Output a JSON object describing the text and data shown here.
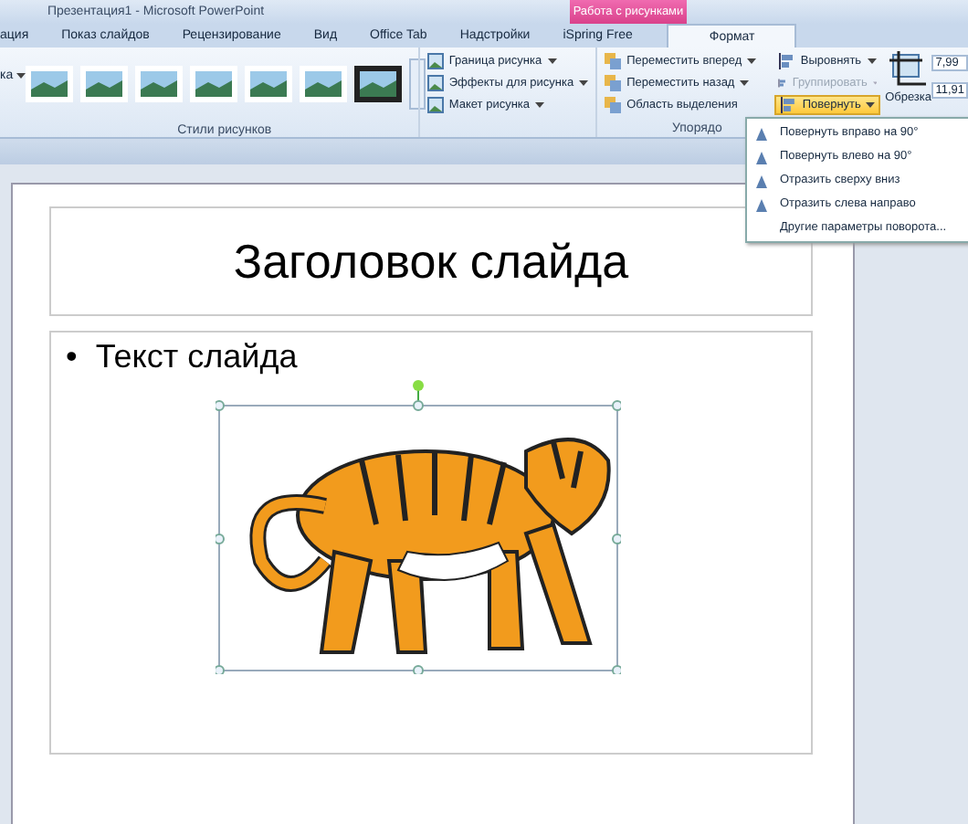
{
  "window": {
    "title": "Презентация1 - Microsoft PowerPoint",
    "context_tab": "Работа с рисунками"
  },
  "tabs": [
    {
      "label": "ация",
      "selected": false
    },
    {
      "label": "Показ слайдов",
      "selected": false
    },
    {
      "label": "Рецензирование",
      "selected": false
    },
    {
      "label": "Вид",
      "selected": false
    },
    {
      "label": "Office Tab",
      "selected": false
    },
    {
      "label": "Надстройки",
      "selected": false
    },
    {
      "label": "iSpring Free",
      "selected": false
    },
    {
      "label": "Формат",
      "selected": true
    }
  ],
  "ribbon": {
    "left_cut": "ка",
    "styles_label": "Стили рисунков",
    "picture_buttons": [
      "Граница рисунка",
      "Эффекты для рисунка",
      "Макет рисунка"
    ],
    "arrange_buttons": [
      {
        "label": "Переместить вперед",
        "dropdown": true
      },
      {
        "label": "Переместить назад",
        "dropdown": true
      },
      {
        "label": "Область выделения",
        "dropdown": false
      }
    ],
    "align_buttons": [
      {
        "label": "Выровнять",
        "disabled": false,
        "open": false
      },
      {
        "label": "Группировать",
        "disabled": true,
        "open": false
      },
      {
        "label": "Повернуть",
        "disabled": false,
        "open": true
      }
    ],
    "arrange_label": "Упорядо",
    "crop_label": "Обрезка",
    "sizes": [
      "7,99",
      "11,91"
    ]
  },
  "rotate_menu": [
    "Повернуть вправо на 90°",
    "Повернуть влево на 90°",
    "Отразить сверху вниз",
    "Отразить слева направо",
    "Другие параметры поворота..."
  ],
  "slide": {
    "title": "Заголовок слайда",
    "bullet": "•",
    "text": "Текст слайда"
  }
}
